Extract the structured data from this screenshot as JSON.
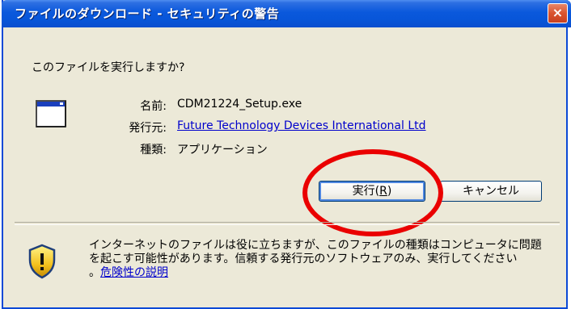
{
  "dialog": {
    "title": "ファイルのダウンロード - セキュリティの警告",
    "close_label": "×",
    "prompt": "このファイルを実行しますか?",
    "name_label": "名前:",
    "name_value": "CDM21224_Setup.exe",
    "publisher_label": "発行元:",
    "publisher_value": "Future Technology Devices International Ltd",
    "type_label": "種類:",
    "type_value": "アプリケーション",
    "run_button_prefix": "実行(",
    "run_button_key": "R",
    "run_button_suffix": ")",
    "cancel_button": "キャンセル",
    "warning_line1": "インターネットのファイルは役に立ちますが、このファイルの種類はコンピュータに問題",
    "warning_line2": "を起こす可能性があります。信頼する発行元のソフトウェアのみ、実行してください",
    "warning_line3_prefix": "。",
    "risk_link": "危険性の説明"
  },
  "colors": {
    "titlebar": "#0a58dc",
    "dialog_bg": "#ece9d8",
    "close_button": "#d9542f",
    "link": "#0000cc",
    "annotation_circle": "#ea0000"
  },
  "icons": {
    "app": "application-window-icon",
    "warning": "security-shield-icon",
    "close": "close-icon"
  }
}
